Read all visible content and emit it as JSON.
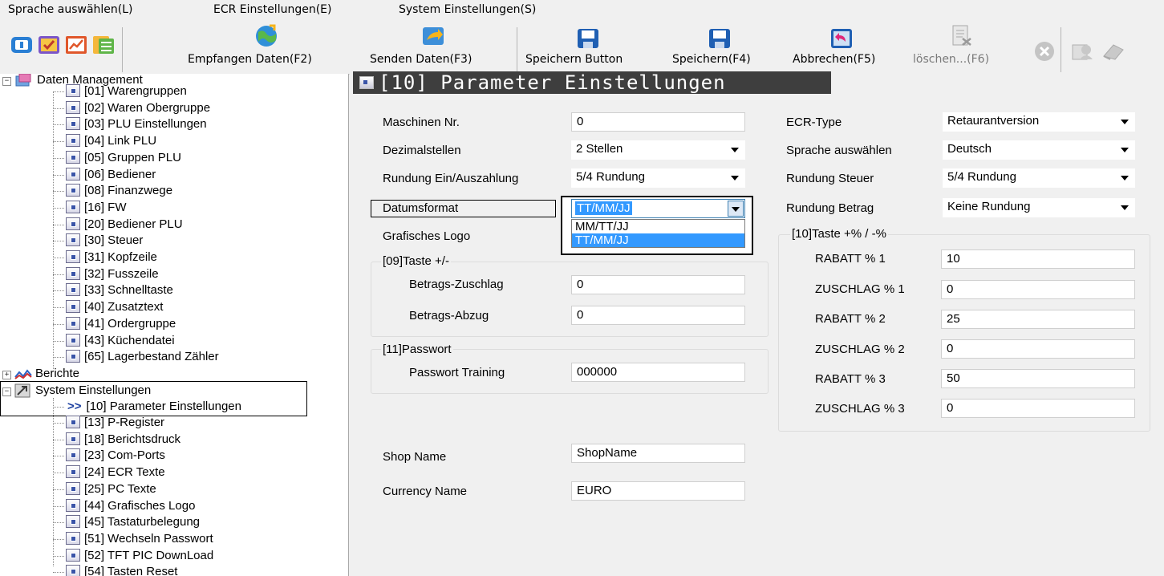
{
  "menu": [
    "Sprache auswählen(L)",
    "ECR Einstellungen(E)",
    "System Einstellungen(S)"
  ],
  "toolbar": {
    "receive_label": "Empfangen Daten(F2)",
    "send_label": "Senden Daten(F3)",
    "save_button_label": "Speichern Button",
    "save_label": "Speichern(F4)",
    "cancel_label": "Abbrechen(F5)",
    "delete_label": "löschen...(F6)"
  },
  "tree": {
    "data_management": "Daten Management",
    "data_items": [
      "[01] Warengruppen",
      "[02] Waren Obergruppe",
      "[03] PLU Einstellungen",
      "[04] Link PLU",
      "[05] Gruppen PLU",
      "[06] Bediener",
      "[08] Finanzwege",
      "[16] FW",
      "[20] Bediener PLU",
      "[30] Steuer",
      "[31] Kopfzeile",
      "[32] Fusszeile",
      "[33] Schnelltaste",
      "[40] Zusatztext",
      "[41] Ordergruppe",
      "[43] Küchendatei",
      "[65] Lagerbestand Zähler"
    ],
    "reports": "Berichte",
    "system_settings": "System Einstellungen",
    "selected_marker": ">>",
    "system_items": [
      "[10] Parameter Einstellungen",
      "[13] P-Register",
      "[18] Berichtsdruck",
      "[23] Com-Ports",
      "[24] ECR Texte",
      "[25] PC Texte",
      "[44] Grafisches Logo",
      "[45] Tastaturbelegung",
      "[51] Wechseln Passwort",
      "[52] TFT PIC DownLoad",
      "[54] Tasten Reset"
    ]
  },
  "page": {
    "title": "[10] Parameter Einstellungen"
  },
  "form": {
    "machine_no_label": "Maschinen Nr.",
    "machine_no_value": "0",
    "decimals_label": "Dezimalstellen",
    "decimals_value": "2 Stellen",
    "rounding_label": "Rundung Ein/Auszahlung",
    "rounding_value": "5/4 Rundung",
    "date_format_label": "Datumsformat",
    "date_format_value": "TT/MM/JJ",
    "date_format_options": [
      "MM/TT/JJ",
      "TT/MM/JJ"
    ],
    "logo_label": "Grafisches Logo",
    "group09_title": "[09]Taste +/-",
    "surcharge_label": "Betrags-Zuschlag",
    "surcharge_value": "0",
    "deduction_label": "Betrags-Abzug",
    "deduction_value": "0",
    "group11_title": "[11]Passwort",
    "password_training_label": "Passwort Training",
    "password_training_value": "000000",
    "shop_name_label": "Shop Name",
    "shop_name_value": "ShopName",
    "currency_name_label": "Currency Name",
    "currency_name_value": "EURO",
    "ecr_type_label": "ECR-Type",
    "ecr_type_value": "Retaurantversion",
    "language_label": "Sprache auswählen",
    "language_value": "Deutsch",
    "rounding_tax_label": "Rundung Steuer",
    "rounding_tax_value": "5/4 Rundung",
    "rounding_amount_label": "Rundung Betrag",
    "rounding_amount_value": "Keine Rundung",
    "group10_title": "[10]Taste +% / -%",
    "rabatt1_label": "RABATT % 1",
    "rabatt1_value": "10",
    "zuschlag1_label": "ZUSCHLAG % 1",
    "zuschlag1_value": "0",
    "rabatt2_label": "RABATT % 2",
    "rabatt2_value": "25",
    "zuschlag2_label": "ZUSCHLAG % 2",
    "zuschlag2_value": "0",
    "rabatt3_label": "RABATT % 3",
    "rabatt3_value": "50",
    "zuschlag3_label": "ZUSCHLAG % 3",
    "zuschlag3_value": "0"
  }
}
